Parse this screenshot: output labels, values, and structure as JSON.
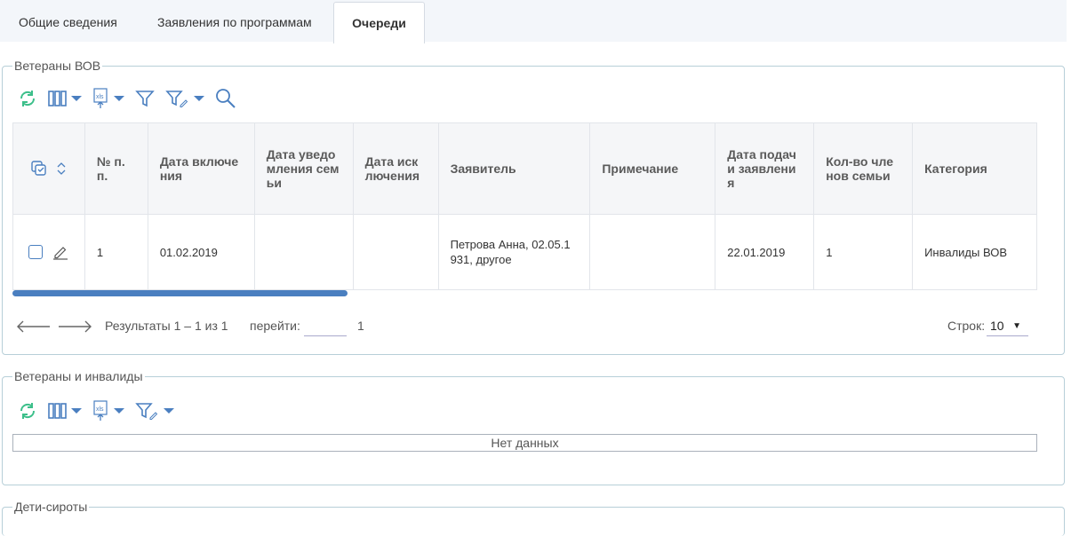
{
  "tabs": [
    {
      "label": "Общие сведения",
      "active": false
    },
    {
      "label": "Заявления по программам",
      "active": false
    },
    {
      "label": "Очереди",
      "active": true
    }
  ],
  "sections": {
    "vov": {
      "title": "Ветераны ВОВ"
    },
    "invalids": {
      "title": "Ветераны и инвалиды",
      "no_data": "Нет данных"
    },
    "orphans": {
      "title": "Дети-сироты"
    }
  },
  "grid": {
    "columns": [
      "№ п.\nп.",
      "Дата включе\nния",
      "Дата уведо\nмления сем\nьи",
      "Дата иск\nлючения",
      "Заявитель",
      "Примечание",
      "Дата подач\nи заявлени\nя",
      "Кол-во чле\nнов семьи",
      "Категория"
    ],
    "rows": [
      {
        "num": "1",
        "date_incl": "01.02.2019",
        "date_notify": "",
        "date_excl": "",
        "applicant": "Петрова Анна, 02.05.1\n931, другое",
        "note": "",
        "date_submit": "22.01.2019",
        "family_count": "1",
        "category": "Инвалиды ВОВ"
      }
    ]
  },
  "pager": {
    "results": "Результаты 1 – 1 из 1",
    "goto_label": "перейти:",
    "page": "1",
    "rows_label": "Строк:",
    "rows_value": "10"
  },
  "icons": {
    "refresh": "refresh-icon",
    "columns": "columns-icon",
    "export": "xls-export-icon",
    "filter": "filter-icon",
    "filter_edit": "filter-edit-icon",
    "search": "search-icon"
  },
  "colors": {
    "accent": "#4a7fc0",
    "refresh": "#3cbf8a",
    "border": "#b7cfd8"
  }
}
